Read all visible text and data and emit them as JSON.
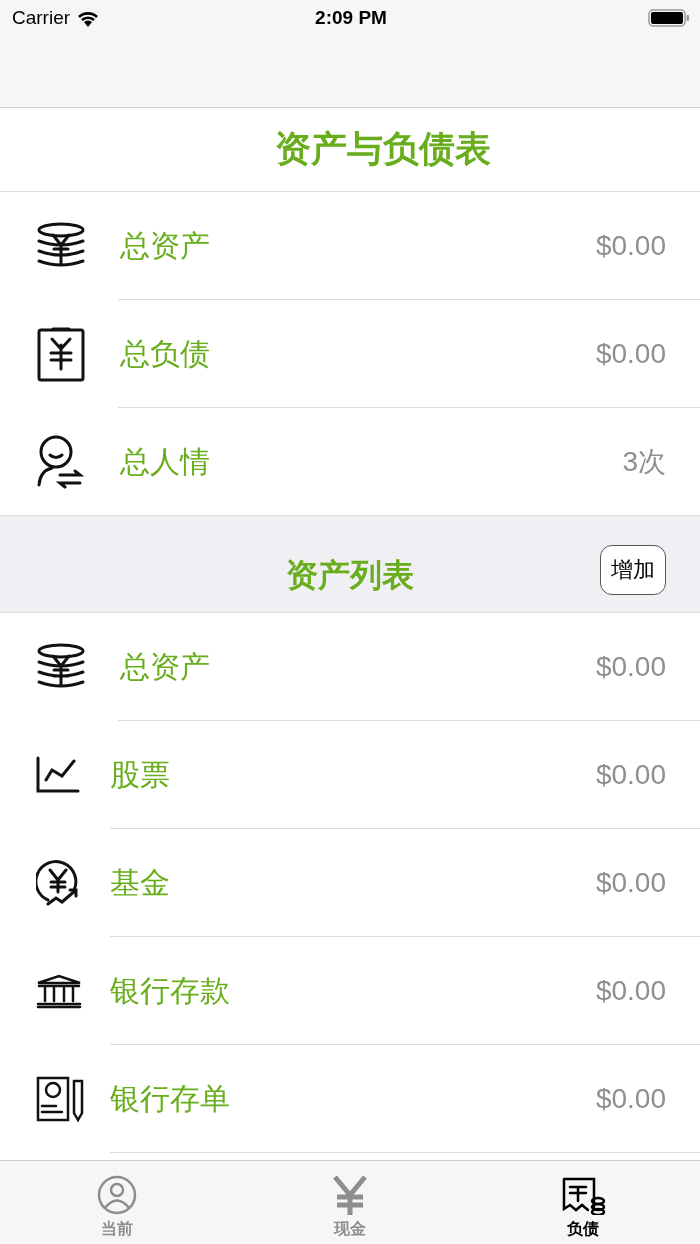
{
  "status_bar": {
    "carrier": "Carrier",
    "time": "2:09 PM"
  },
  "summary": {
    "title": "资产与负债表",
    "rows": [
      {
        "kind": "coins",
        "label": "总资产",
        "value": "$0.00"
      },
      {
        "kind": "clipboard",
        "label": "总负债",
        "value": "$0.00"
      },
      {
        "kind": "person",
        "label": "总人情",
        "value": "3次"
      }
    ]
  },
  "assets": {
    "title": "资产列表",
    "add_button": "增加",
    "rows": [
      {
        "kind": "coins",
        "label": "总资产",
        "value": "$0.00"
      },
      {
        "kind": "chart",
        "label": "股票",
        "value": "$0.00"
      },
      {
        "kind": "fund",
        "label": "基金",
        "value": "$0.00"
      },
      {
        "kind": "bank",
        "label": "银行存款",
        "value": "$0.00"
      },
      {
        "kind": "certificate",
        "label": "银行存单",
        "value": "$0.00"
      }
    ]
  },
  "tab_bar": [
    {
      "kind": "person",
      "label": "当前",
      "selected": false
    },
    {
      "kind": "yen",
      "label": "现金",
      "selected": false
    },
    {
      "kind": "debt",
      "label": "负债",
      "selected": true
    }
  ]
}
